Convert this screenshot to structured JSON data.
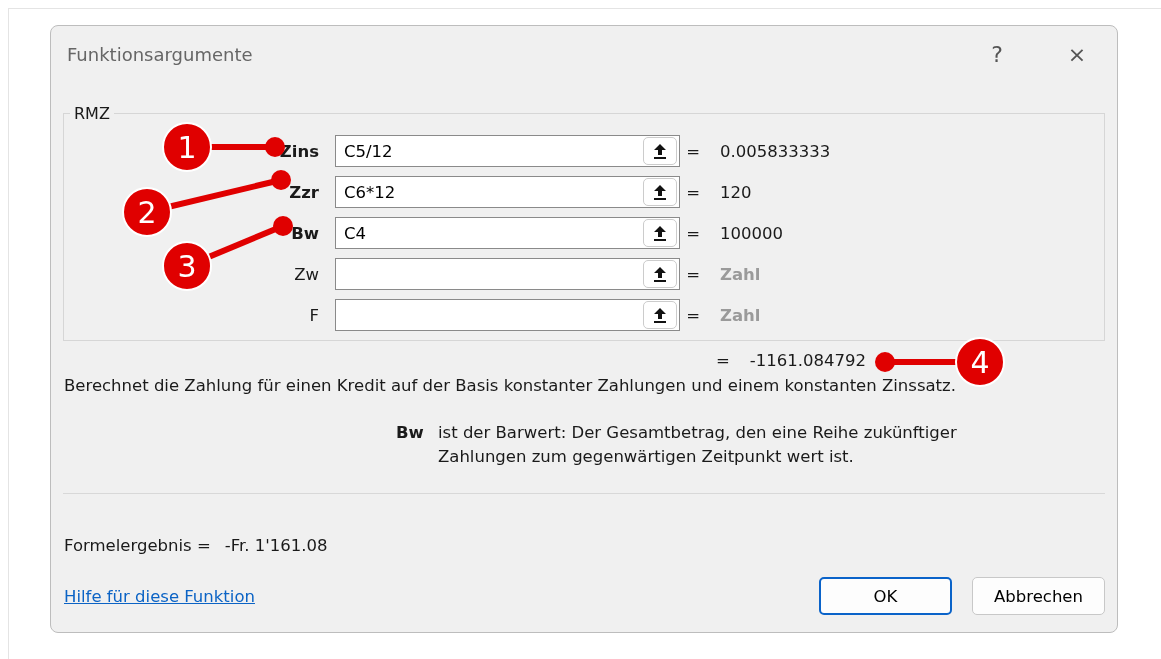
{
  "window": {
    "title": "Funktionsargumente",
    "help_button": "?",
    "close_button": "×"
  },
  "function": {
    "name": "RMZ",
    "arguments": [
      {
        "name": "Zins",
        "required": true,
        "value": "C5/12",
        "result": "0.005833333",
        "result_dimmed": false
      },
      {
        "name": "Zzr",
        "required": true,
        "value": "C6*12",
        "result": "120",
        "result_dimmed": false
      },
      {
        "name": "Bw",
        "required": true,
        "value": "C4",
        "result": "100000",
        "result_dimmed": false
      },
      {
        "name": "Zw",
        "required": false,
        "result": "Zahl",
        "result_dimmed": true
      },
      {
        "name": "F",
        "required": false,
        "result": "Zahl",
        "result_dimmed": true
      }
    ],
    "result": "-1161.084792"
  },
  "equals": "=",
  "description": "Berechnet die Zahlung für einen Kredit auf der Basis konstanter Zahlungen und einem konstanten Zinssatz.",
  "argument_help": {
    "name": "Bw",
    "text": "ist der Barwert: Der Gesamtbetrag, den eine Reihe zukünftiger Zahlungen zum gegenwärtigen Zeitpunkt wert ist."
  },
  "formula_result": {
    "label": "Formelergebnis =",
    "value": "-Fr. 1'161.08"
  },
  "help_link": "Hilfe für diese Funktion",
  "buttons": [
    {
      "label": "OK",
      "default": true
    },
    {
      "label": "Abbrechen",
      "default": false
    }
  ],
  "callouts": [
    {
      "number": "1"
    },
    {
      "number": "2"
    },
    {
      "number": "3"
    },
    {
      "number": "4"
    }
  ]
}
